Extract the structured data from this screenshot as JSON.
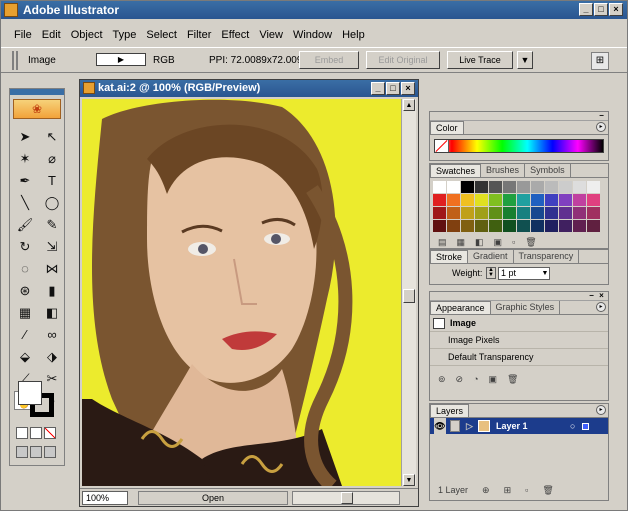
{
  "window": {
    "title": "Adobe Illustrator",
    "min": "_",
    "max": "□",
    "close": "×"
  },
  "menu": [
    "File",
    "Edit",
    "Object",
    "Type",
    "Select",
    "Filter",
    "Effect",
    "View",
    "Window",
    "Help"
  ],
  "control": {
    "selection_label": "Image",
    "color_mode": "RGB",
    "ppi": "PPI: 72.0089x72.0091",
    "embed": "Embed",
    "edit_original": "Edit Original",
    "live_trace": "Live Trace",
    "dropdown_arrow": "▼"
  },
  "document": {
    "title": "kat.ai:2 @ 100% (RGB/Preview)",
    "zoom": "100%",
    "status": "Open",
    "canvas_bg": "#eceb2d"
  },
  "color_panel": {
    "tab": "Color",
    "menu": "▸"
  },
  "swatches_panel": {
    "tabs": [
      "Swatches",
      "Brushes",
      "Symbols"
    ]
  },
  "stroke_panel": {
    "tabs": [
      "Stroke",
      "Gradient",
      "Transparency"
    ],
    "weight_label": "Weight:",
    "weight_value": "1 pt"
  },
  "appearance_panel": {
    "tabs": [
      "Appearance",
      "Graphic Styles"
    ],
    "items": [
      "Image",
      "Image Pixels",
      "Default Transparency"
    ]
  },
  "layers_panel": {
    "tab": "Layers",
    "layer_name": "Layer 1",
    "footer": "1 Layer"
  }
}
